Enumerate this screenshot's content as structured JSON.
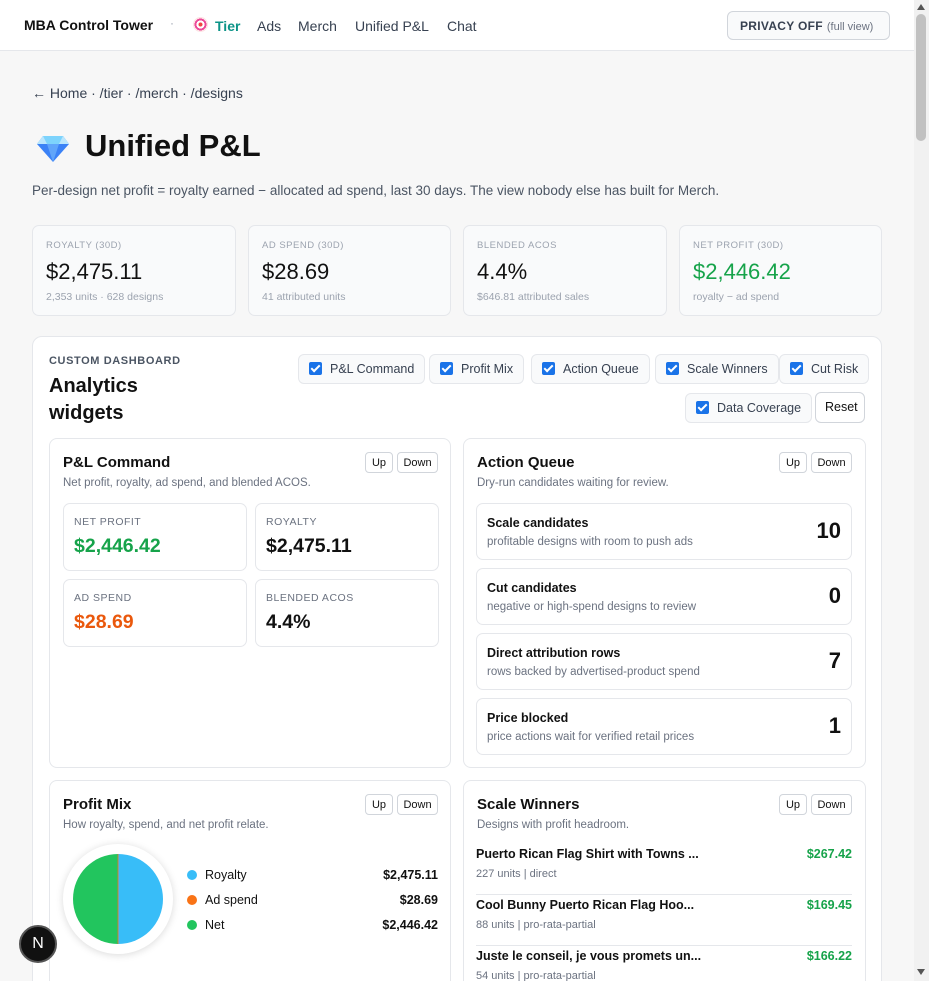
{
  "nav": {
    "brand": "MBA Control Tower",
    "separator": "·",
    "items": [
      {
        "label": "Tier"
      },
      {
        "label": "Ads"
      },
      {
        "label": "Merch"
      },
      {
        "label": "Unified P&L"
      },
      {
        "label": "Chat"
      }
    ],
    "privacy": {
      "label": "PRIVACY OFF",
      "sub": "(full view)"
    }
  },
  "breadcrumb": "← Home · /tier · /merch · /designs",
  "page": {
    "title": "Unified P&L",
    "subtitle": "Per-design net profit = royalty earned − allocated ad spend, last 30 days. The view nobody else has built for Merch."
  },
  "stats": [
    {
      "label": "ROYALTY (30D)",
      "value": "$2,475.11",
      "sub": "2,353 units · 628 designs"
    },
    {
      "label": "AD SPEND (30D)",
      "value": "$28.69",
      "sub": "41 attributed units"
    },
    {
      "label": "BLENDED ACOS",
      "value": "4.4%",
      "sub": "$646.81 attributed sales"
    },
    {
      "label": "NET PROFIT (30D)",
      "value": "$2,446.42",
      "sub": "royalty − ad spend"
    }
  ],
  "dashboard": {
    "eyebrow": "CUSTOM DASHBOARD",
    "title": "Analytics widgets",
    "toggles": [
      "P&L Command",
      "Profit Mix",
      "Action Queue",
      "Scale Winners",
      "Cut Risk",
      "Data Coverage"
    ],
    "reset": "Reset",
    "up": "Up",
    "down": "Down"
  },
  "pl_command": {
    "title": "P&L Command",
    "desc": "Net profit, royalty, ad spend, and blended ACOS.",
    "kpis": [
      {
        "label": "NET PROFIT",
        "value": "$2,446.42"
      },
      {
        "label": "ROYALTY",
        "value": "$2,475.11"
      },
      {
        "label": "AD SPEND",
        "value": "$28.69"
      },
      {
        "label": "BLENDED ACOS",
        "value": "4.4%"
      }
    ]
  },
  "action_queue": {
    "title": "Action Queue",
    "desc": "Dry-run candidates waiting for review.",
    "items": [
      {
        "title": "Scale candidates",
        "desc": "profitable designs with room to push ads",
        "count": "10"
      },
      {
        "title": "Cut candidates",
        "desc": "negative or high-spend designs to review",
        "count": "0"
      },
      {
        "title": "Direct attribution rows",
        "desc": "rows backed by advertised-product spend",
        "count": "7"
      },
      {
        "title": "Price blocked",
        "desc": "price actions wait for verified retail prices",
        "count": "1"
      }
    ]
  },
  "profit_mix": {
    "title": "Profit Mix",
    "desc": "How royalty, spend, and net profit relate.",
    "legend": [
      {
        "label": "Royalty",
        "value": "$2,475.11",
        "color": "#38bdf8"
      },
      {
        "label": "Ad spend",
        "value": "$28.69",
        "color": "#f97316"
      },
      {
        "label": "Net",
        "value": "$2,446.42",
        "color": "#22c55e"
      }
    ]
  },
  "scale_winners": {
    "title": "Scale Winners",
    "desc": "Designs with profit headroom.",
    "rows": [
      {
        "title": "Puerto Rican Flag Shirt with Towns ...",
        "meta": "227 units | direct",
        "value": "$267.42"
      },
      {
        "title": "Cool Bunny Puerto Rican Flag Hoo...",
        "meta": "88 units | pro-rata-partial",
        "value": "$169.45"
      },
      {
        "title": "Juste le conseil, je vous promets un...",
        "meta": "54 units | pro-rata-partial",
        "value": "$166.22"
      }
    ]
  },
  "badge": "N",
  "colors": {
    "accent": "#0d9488",
    "positive": "#16a34a",
    "negative": "#ea580c",
    "checkbox": "#1a73e8"
  }
}
